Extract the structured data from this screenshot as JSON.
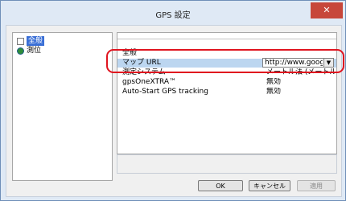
{
  "window": {
    "title": "GPS 設定",
    "close_glyph": "✕"
  },
  "tree": {
    "items": [
      {
        "label": "全般",
        "icon": "document-icon",
        "selected": true
      },
      {
        "label": "測位",
        "icon": "globe-icon",
        "selected": false
      }
    ]
  },
  "properties": {
    "category": "全般",
    "rows": [
      {
        "name": "マップ URL",
        "value": "http://www.google...",
        "selected": true
      },
      {
        "name": "測定システム",
        "value": "メートル法 (メートル, キ...",
        "selected": false
      },
      {
        "name": "gpsOneXTRA™",
        "value": "無効",
        "selected": false
      },
      {
        "name": "Auto-Start GPS tracking",
        "value": "無効",
        "selected": false
      }
    ]
  },
  "buttons": {
    "ok": "OK",
    "cancel": "キャンセル",
    "apply": "適用"
  },
  "colors": {
    "highlight": "#e0141f",
    "selection": "#3a6fd6",
    "close": "#c7473b"
  }
}
